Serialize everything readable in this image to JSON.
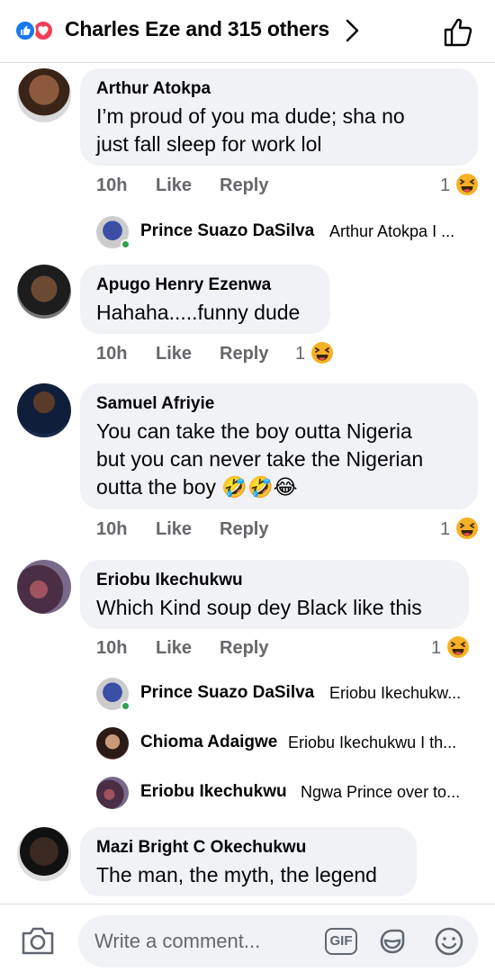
{
  "header": {
    "title": "Charles Eze and 315 others"
  },
  "comments": [
    {
      "author": "Arthur Atokpa",
      "lines": [
        "I’m proud of you ma dude; sha no",
        "just fall sleep for work lol"
      ],
      "time": "10h",
      "like": "Like",
      "reply": "Reply",
      "reactions": "1"
    },
    {
      "author": "Apugo Henry Ezenwa",
      "lines": [
        "Hahaha.....funny dude"
      ],
      "time": "10h",
      "like": "Like",
      "reply": "Reply",
      "reactions": "1"
    },
    {
      "author": "Samuel Afriyie",
      "lines": [
        "You can take the boy outta Nigeria",
        "but you can never take the Nigerian",
        "outta the boy 🤣🤣😂"
      ],
      "time": "10h",
      "like": "Like",
      "reply": "Reply",
      "reactions": "1"
    },
    {
      "author": "Eriobu Ikechukwu",
      "lines": [
        "Which Kind soup  dey Black like this"
      ],
      "time": "10h",
      "like": "Like",
      "reply": "Reply",
      "reactions": "1"
    },
    {
      "author": "Mazi Bright C Okechukwu",
      "lines": [
        "The man, the myth, the legend"
      ]
    }
  ],
  "replies": [
    {
      "name": "Prince Suazo DaSilva",
      "snippet": "Arthur Atokpa  I ..."
    },
    {
      "name": "Prince Suazo DaSilva",
      "snippet": "Eriobu Ikechukw..."
    },
    {
      "name": "Chioma Adaigwe",
      "snippet": "Eriobu Ikechukwu I th..."
    },
    {
      "name": "Eriobu Ikechukwu",
      "snippet": "Ngwa Prince over to..."
    }
  ],
  "composer": {
    "placeholder": "Write a comment...",
    "gif_label": "GIF"
  },
  "icons": {
    "header": [
      "like-reaction-icon",
      "love-reaction-icon",
      "chevron-right-icon",
      "thumbs-up-icon"
    ],
    "footer": [
      "camera-icon",
      "gif-icon",
      "sticker-icon",
      "emoji-icon"
    ],
    "reaction": "laughing-emoji-icon"
  },
  "colors": {
    "like_blue": "#1877f2",
    "love_red": "#f33e58",
    "bubble_bg": "#f0f2f5",
    "meta_gray": "#65676b",
    "online_green": "#31a24c",
    "laugh_yellow": "#f7b125"
  }
}
